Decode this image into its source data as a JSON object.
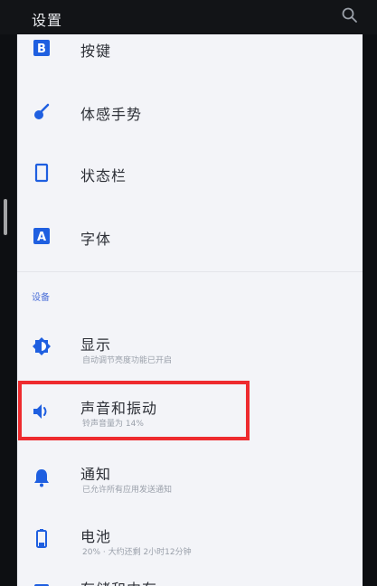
{
  "header": {
    "title": "设置",
    "search_icon": "search-icon"
  },
  "items": {
    "keys": {
      "label": "按键",
      "icon": "keyboard-b-icon"
    },
    "gestures": {
      "label": "体感手势",
      "icon": "gesture-icon"
    },
    "status_bar": {
      "label": "状态栏",
      "icon": "phone-frame-icon"
    },
    "font": {
      "label": "字体",
      "icon": "font-a-icon"
    },
    "section_device": "设备",
    "display": {
      "label": "显示",
      "sub": "自动调节亮度功能已开启",
      "icon": "brightness-icon"
    },
    "sound": {
      "label": "声音和振动",
      "sub": "铃声音量为 14%",
      "icon": "speaker-icon"
    },
    "notifications": {
      "label": "通知",
      "sub": "已允许所有应用发送通知",
      "icon": "bell-icon"
    },
    "battery": {
      "label": "电池",
      "sub": "20% · 大约还剩 2小时12分钟",
      "icon": "battery-icon"
    },
    "storage": {
      "label": "存储和内存",
      "icon": "storage-icon"
    }
  },
  "colors": {
    "accent": "#1f5fe0",
    "highlight": "#ee2b2f",
    "background": "#f3f4f8",
    "topbar": "#121417"
  }
}
